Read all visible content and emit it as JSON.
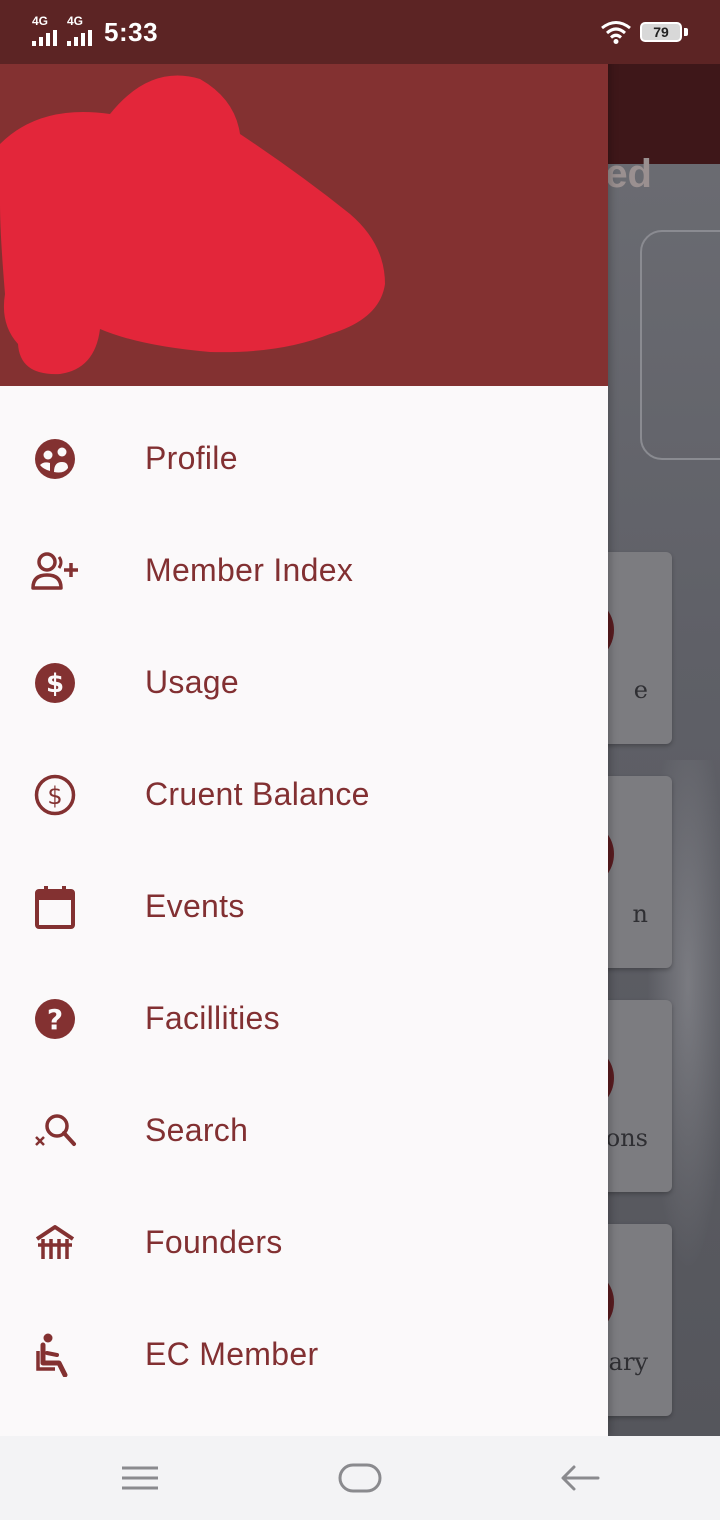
{
  "status_bar": {
    "network_1": "4G",
    "network_2": "4G",
    "time": "5:33",
    "battery": "79"
  },
  "background_app": {
    "title_fragment": "ed",
    "card_labels": [
      "e",
      "n",
      "ons",
      "ary"
    ]
  },
  "drawer": {
    "accent_color": "#833131",
    "text_color": "#823032",
    "items": [
      {
        "label": "Profile",
        "icon": "profile-icon"
      },
      {
        "label": "Member Index",
        "icon": "add-user-icon"
      },
      {
        "label": "Usage",
        "icon": "dollar-filled-icon"
      },
      {
        "label": "Cruent Balance",
        "icon": "dollar-outline-icon"
      },
      {
        "label": "Events",
        "icon": "calendar-icon"
      },
      {
        "label": "Facillities",
        "icon": "question-icon"
      },
      {
        "label": "Search",
        "icon": "search-icon"
      },
      {
        "label": "Founders",
        "icon": "building-icon"
      },
      {
        "label": "EC Member",
        "icon": "seat-person-icon"
      }
    ]
  },
  "nav_bar": {
    "icons": [
      "menu-icon",
      "home-icon",
      "back-icon"
    ]
  }
}
